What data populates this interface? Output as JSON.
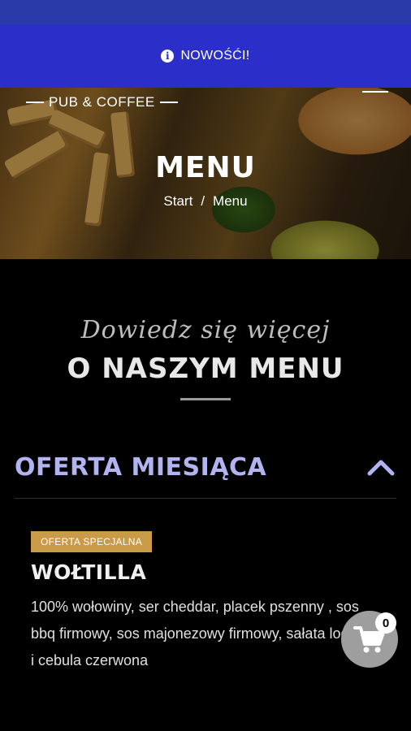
{
  "notice": {
    "icon": "info-icon",
    "text": "NOWOŚĆI!"
  },
  "hero": {
    "brand": "PUB & COFFEE",
    "title": "MENU",
    "breadcrumb": {
      "home": "Start",
      "separator": "/",
      "current": "Menu"
    }
  },
  "intro": {
    "script": "Dowiedz się więcej",
    "heading": "O NASZYM MENU"
  },
  "offer_section": {
    "title": "OFERTA MIESIĄCA",
    "toggle_icon": "chevron-up-icon",
    "item": {
      "badge": "OFERTA SPECJALNA",
      "name": "WOŁTILLA",
      "description": "100% wołowiny, ser cheddar, placek pszenny , sos bbq firmowy, sos majonezowy firmowy, sałata lodowa i cebula czerwona"
    }
  },
  "cart": {
    "icon": "cart-icon",
    "count": "0"
  },
  "colors": {
    "notice_bg": "#2b2ec9",
    "status_bg": "#2a3aa8",
    "accent_text": "#b2b4f2",
    "badge_bg": "#c99a47",
    "cart_bg": "#9e9e9e"
  }
}
